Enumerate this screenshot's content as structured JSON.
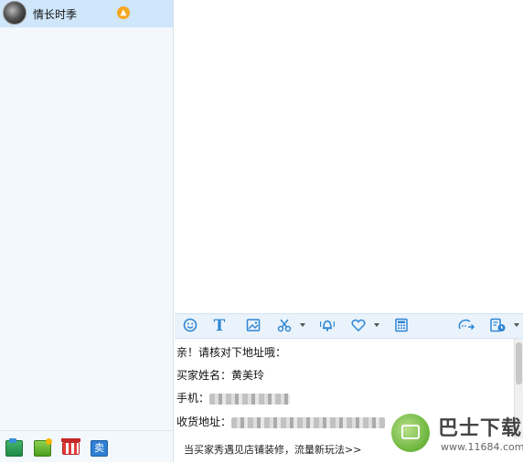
{
  "contact": {
    "name": "情长时季",
    "badge_icon": "seller-badge-icon",
    "badge_color": "#f5a623"
  },
  "left_toolbar": {
    "icons": [
      "store-icon",
      "wallet-icon",
      "shop-icon",
      "sell-icon"
    ],
    "sell_glyph": "卖"
  },
  "chat_toolbar": {
    "icons": [
      "emoji-icon",
      "font-icon",
      "image-icon",
      "screenshot-icon",
      "bell-icon",
      "favorite-icon",
      "calculator-icon",
      "transfer-icon",
      "history-icon"
    ],
    "font_glyph": "T"
  },
  "message": {
    "lines": [
      {
        "text": "亲！请核对下地址哦："
      },
      {
        "label": "买家姓名：",
        "value": "黄美玲"
      },
      {
        "label": "手机："
      },
      {
        "label": "收货地址："
      }
    ]
  },
  "promo": "当买家秀遇见店铺装修，流量新玩法>>",
  "watermark": {
    "title": "巴士下载",
    "url": "www.11684.com"
  },
  "accent_color": "#2f86d3"
}
